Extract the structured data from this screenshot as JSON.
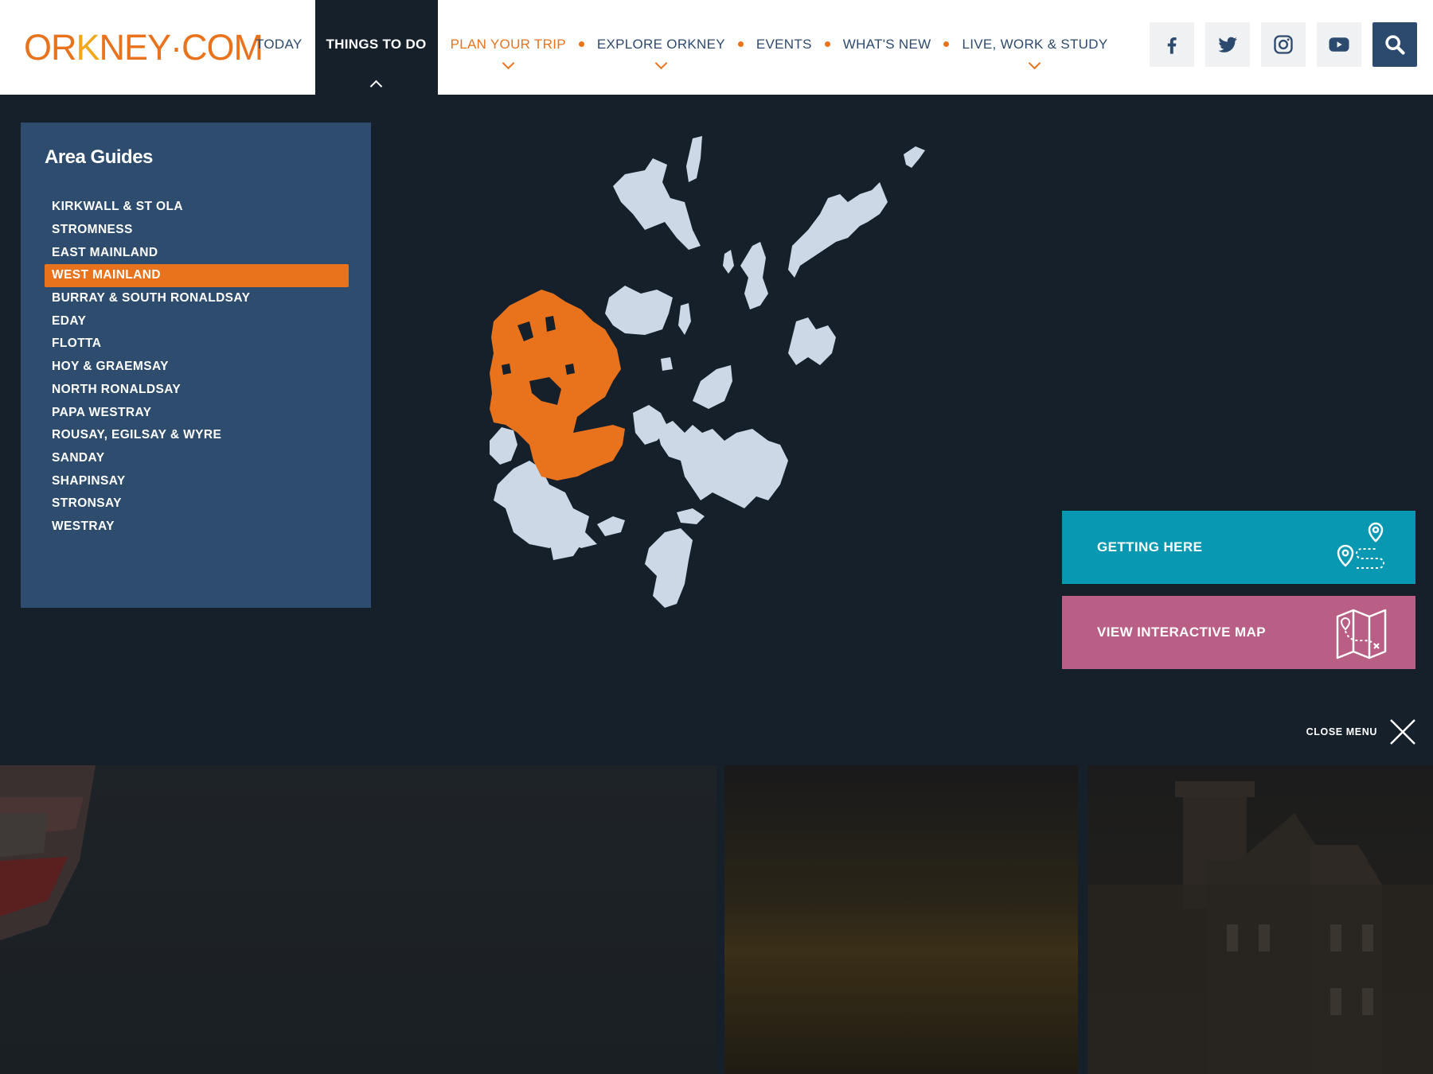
{
  "brand": {
    "logo_parts": [
      "OR",
      "K",
      "NEY",
      "·COM"
    ],
    "colors": {
      "orange": "#e8731c",
      "navy": "#2c4a6e",
      "teal": "#0898b2",
      "pink": "#b95e85",
      "panel": "#2e4d6e",
      "dark": "#15202b"
    }
  },
  "nav": {
    "items": [
      {
        "label": "TODAY"
      },
      {
        "label": "THINGS TO DO"
      },
      {
        "label": "PLAN YOUR TRIP"
      },
      {
        "label": "EXPLORE ORKNEY"
      },
      {
        "label": "EVENTS"
      },
      {
        "label": "WHAT'S NEW"
      },
      {
        "label": "LIVE, WORK & STUDY"
      }
    ]
  },
  "social": [
    "facebook-icon",
    "twitter-icon",
    "instagram-icon",
    "youtube-icon",
    "search-icon"
  ],
  "area_guides": {
    "title": "Area Guides",
    "items": [
      "KIRKWALL & ST OLA",
      "STROMNESS",
      "EAST MAINLAND",
      "WEST MAINLAND",
      "BURRAY & SOUTH RONALDSAY",
      "EDAY",
      "FLOTTA",
      "HOY & GRAEMSAY",
      "NORTH RONALDSAY",
      "PAPA WESTRAY",
      "ROUSAY, EGILSAY & WYRE",
      "SANDAY",
      "SHAPINSAY",
      "STRONSAY",
      "WESTRAY"
    ],
    "selected": "WEST MAINLAND"
  },
  "cta": {
    "getting_here": "GETTING HERE",
    "interactive_map": "VIEW INTERACTIVE MAP"
  },
  "close_menu": "CLOSE MENU"
}
